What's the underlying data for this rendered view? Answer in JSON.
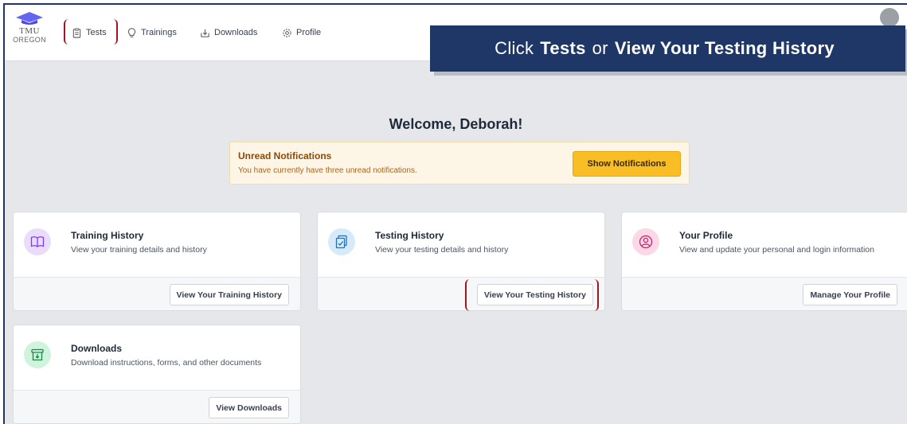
{
  "logo": {
    "line1": "TMU",
    "line2": "OREGON"
  },
  "nav": [
    {
      "label": "Tests",
      "icon": "clipboard-icon"
    },
    {
      "label": "Trainings",
      "icon": "lightbulb-icon"
    },
    {
      "label": "Downloads",
      "icon": "download-icon"
    },
    {
      "label": "Profile",
      "icon": "gear-icon"
    }
  ],
  "callout": {
    "prefix": "Click",
    "target1": "Tests",
    "conj": "or",
    "target2": "View Your Testing History"
  },
  "welcome": "Welcome, Deborah!",
  "notification": {
    "title": "Unread Notifications",
    "text": "You have currently have three unread notifications.",
    "button": "Show Notifications"
  },
  "cards": [
    {
      "title": "Training History",
      "desc": "View your training details and history",
      "button": "View Your Training History",
      "icon": "book-icon",
      "icon_bg": "#eadcfb",
      "icon_color": "#7c3aed"
    },
    {
      "title": "Testing History",
      "desc": "View your testing details and history",
      "button": "View Your Testing History",
      "icon": "clipboard-check-icon",
      "icon_bg": "#d5ebfb",
      "icon_color": "#1f6fb5"
    },
    {
      "title": "Your Profile",
      "desc": "View and update your personal and login information",
      "button": "Manage Your Profile",
      "icon": "user-circle-icon",
      "icon_bg": "#fbd7e8",
      "icon_color": "#c0266b"
    },
    {
      "title": "Downloads",
      "desc": "Download instructions, forms, and other documents",
      "button": "View Downloads",
      "icon": "archive-download-icon",
      "icon_bg": "#cff3dc",
      "icon_color": "#178a4c"
    }
  ],
  "colors": {
    "brand_navy": "#1e3766",
    "highlight_red": "#a31621",
    "warning_yellow": "#f9bd26"
  }
}
